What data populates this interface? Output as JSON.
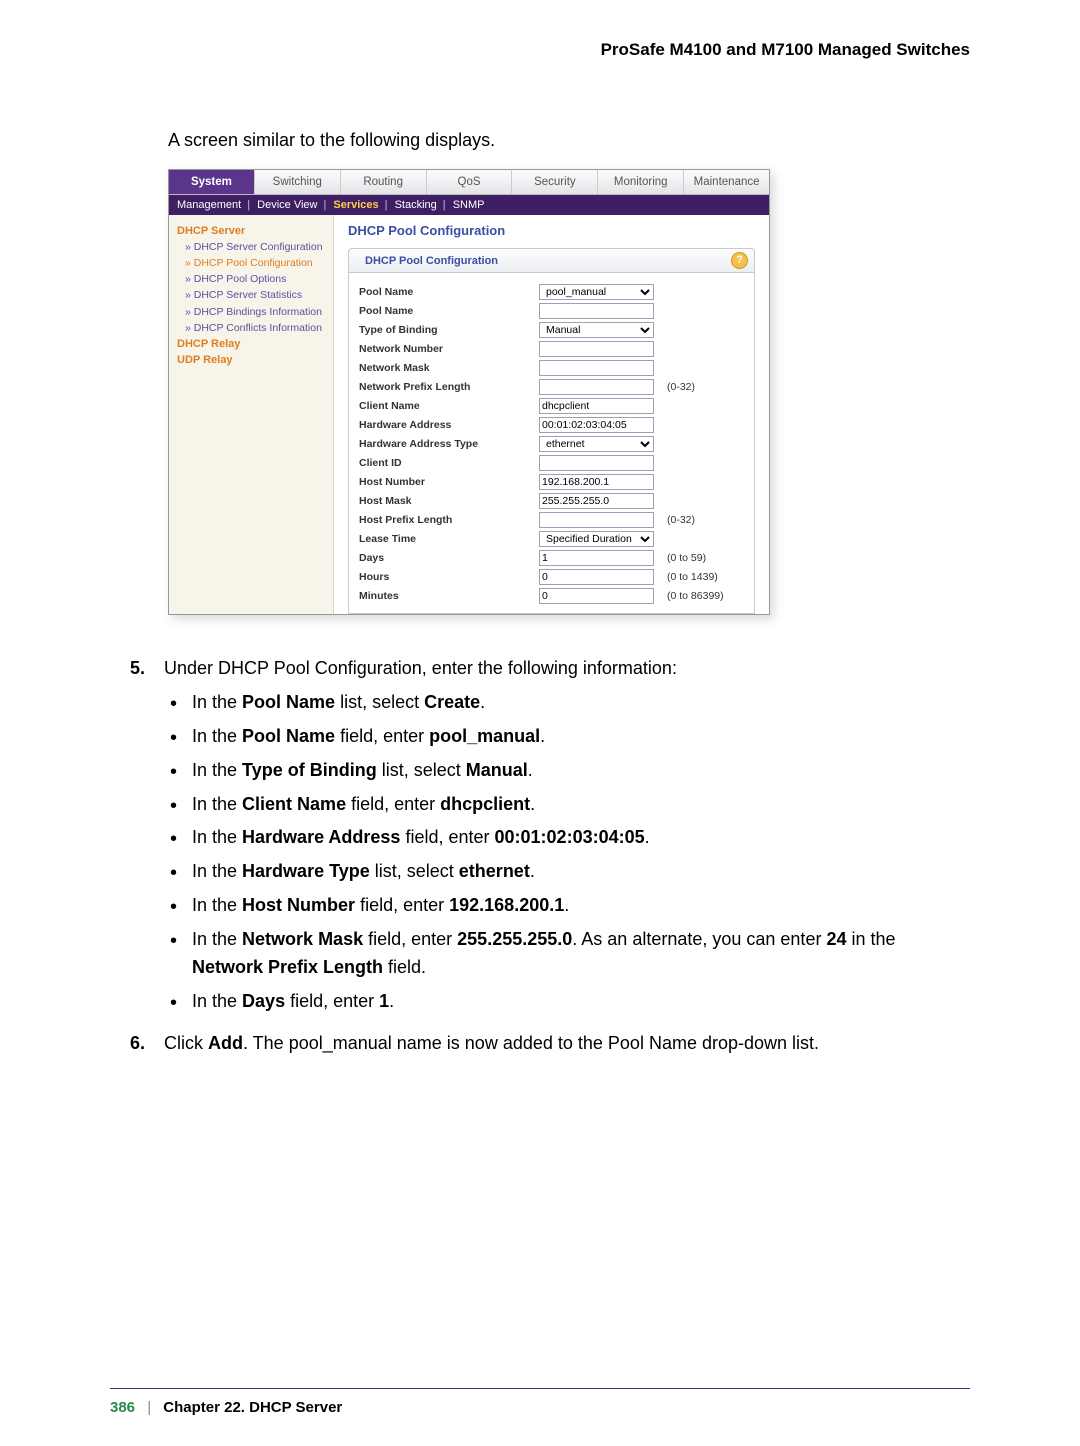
{
  "doc_title": "ProSafe M4100 and M7100 Managed Switches",
  "intro_text": "A screen similar to the following displays.",
  "tabs": {
    "t0": "System",
    "t1": "Switching",
    "t2": "Routing",
    "t3": "QoS",
    "t4": "Security",
    "t5": "Monitoring",
    "t6": "Maintenance"
  },
  "subnav": {
    "management": "Management",
    "device_view": "Device View",
    "services": "Services",
    "stacking": "Stacking",
    "snmp": "SNMP"
  },
  "sidebar": {
    "sec1": "DHCP Server",
    "l1": "» DHCP Server Configuration",
    "l2": "» DHCP Pool Configuration",
    "l3": "» DHCP Pool Options",
    "l4": "» DHCP Server Statistics",
    "l5": "» DHCP Bindings Information",
    "l6": "» DHCP Conflicts Information",
    "sec2": "DHCP Relay",
    "sec3": "UDP Relay"
  },
  "content_title": "DHCP Pool Configuration",
  "panel_title": "DHCP Pool Configuration",
  "help_glyph": "?",
  "fields": {
    "pool_name_l": "Pool Name",
    "pool_name_v": "pool_manual",
    "pool_name2_l": "Pool Name",
    "pool_name2_v": "",
    "binding_l": "Type of Binding",
    "binding_v": "Manual",
    "net_num_l": "Network Number",
    "net_num_v": "",
    "net_mask_l": "Network Mask",
    "net_mask_v": "",
    "net_pfx_l": "Network Prefix Length",
    "net_pfx_v": "",
    "net_pfx_n": "(0-32)",
    "client_name_l": "Client Name",
    "client_name_v": "dhcpclient",
    "hw_addr_l": "Hardware Address",
    "hw_addr_v": "00:01:02:03:04:05",
    "hw_type_l": "Hardware Address Type",
    "hw_type_v": "ethernet",
    "client_id_l": "Client ID",
    "client_id_v": "",
    "host_num_l": "Host Number",
    "host_num_v": "192.168.200.1",
    "host_mask_l": "Host Mask",
    "host_mask_v": "255.255.255.0",
    "host_pfx_l": "Host Prefix Length",
    "host_pfx_v": "",
    "host_pfx_n": "(0-32)",
    "lease_l": "Lease Time",
    "lease_v": "Specified Duration",
    "days_l": "Days",
    "days_v": "1",
    "days_n": "(0 to 59)",
    "hours_l": "Hours",
    "hours_v": "0",
    "hours_n": "(0 to 1439)",
    "mins_l": "Minutes",
    "mins_v": "0",
    "mins_n": "(0 to 86399)"
  },
  "step5_num": "5.",
  "step5_lead": "Under DHCP Pool Configuration, enter the following information:",
  "b1a": "In the ",
  "b1b": "Pool Name",
  "b1c": " list, select ",
  "b1d": "Create",
  "b1e": ".",
  "b2a": "In the ",
  "b2b": "Pool Name",
  "b2c": " field, enter ",
  "b2d": "pool_manual",
  "b2e": ".",
  "b3a": "In the ",
  "b3b": "Type of Binding",
  "b3c": " list, select ",
  "b3d": "Manual",
  "b3e": ".",
  "b4a": "In the ",
  "b4b": "Client Name",
  "b4c": " field, enter ",
  "b4d": "dhcpclient",
  "b4e": ".",
  "b5a": "In the ",
  "b5b": "Hardware Address",
  "b5c": " field, enter ",
  "b5d": "00:01:02:03:04:05",
  "b5e": ".",
  "b6a": "In the ",
  "b6b": "Hardware Type",
  "b6c": " list, select ",
  "b6d": "ethernet",
  "b6e": ".",
  "b7a": "In the ",
  "b7b": "Host Number",
  "b7c": " field, enter ",
  "b7d": "192.168.200.1",
  "b7e": ".",
  "b8a": "In the ",
  "b8b": "Network Mask",
  "b8c": " field, enter ",
  "b8d": "255.255.255.0",
  "b8e": ". As an alternate, you can enter ",
  "b8f": "24",
  "b8g": " in the ",
  "b8h": "Network Prefix Length",
  "b8i": " field.",
  "b9a": "In the ",
  "b9b": "Days",
  "b9c": " field, enter ",
  "b9d": "1",
  "b9e": ".",
  "step6_num": "6.",
  "s6a": "Click ",
  "s6b": "Add",
  "s6c": ". The pool_manual name is now added to the Pool Name drop-down list.",
  "footer": {
    "page": "386",
    "chapter": "Chapter 22.  DHCP Server"
  }
}
